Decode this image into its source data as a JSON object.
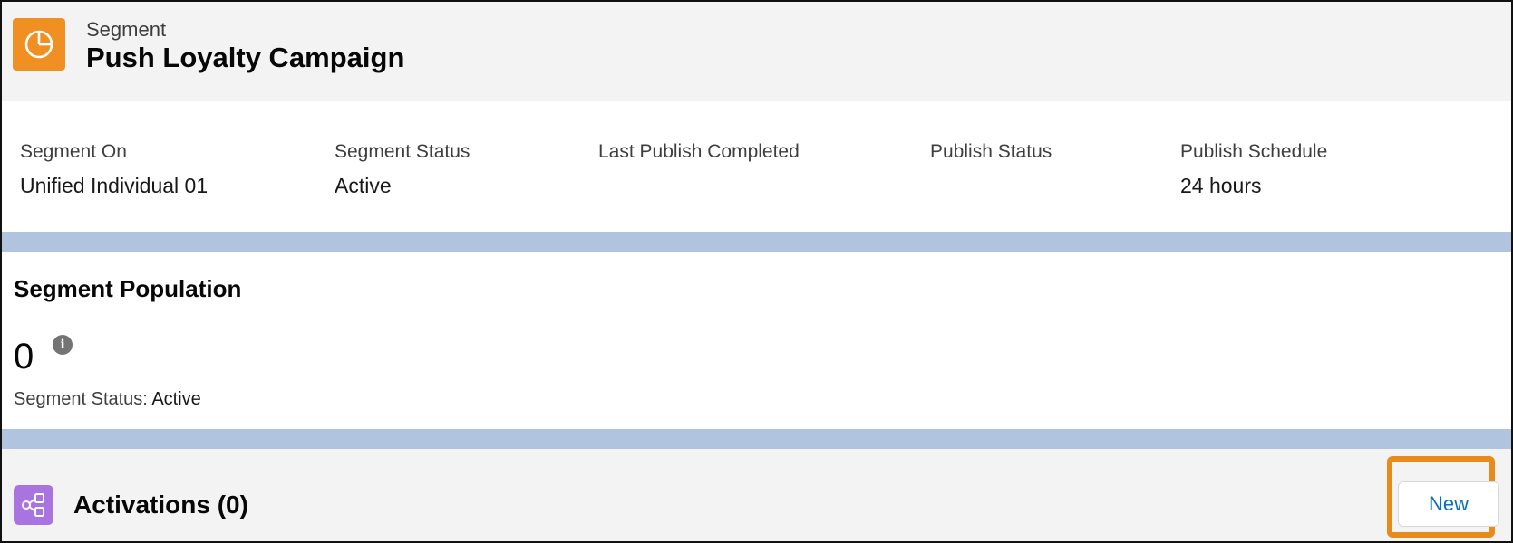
{
  "header": {
    "object_type": "Segment",
    "title": "Push Loyalty Campaign",
    "icon": "pie-chart-icon",
    "icon_color": "#f19022"
  },
  "details": {
    "fields": [
      {
        "label": "Segment On",
        "value": "Unified Individual 01"
      },
      {
        "label": "Segment Status",
        "value": "Active"
      },
      {
        "label": "Last Publish Completed",
        "value": ""
      },
      {
        "label": "Publish Status",
        "value": ""
      },
      {
        "label": "Publish Schedule",
        "value": "24 hours"
      }
    ]
  },
  "population": {
    "title": "Segment Population",
    "count": "0",
    "info_icon": "info-icon",
    "status_label": "Segment Status:",
    "status_value": "Active"
  },
  "activations": {
    "title": "Activations (0)",
    "icon": "activation-flow-icon",
    "icon_color": "#a974e0",
    "new_label": "New",
    "highlight_color": "#e98a1c"
  },
  "colors": {
    "divider": "#b0c4df",
    "link_blue": "#0b6fc2"
  }
}
